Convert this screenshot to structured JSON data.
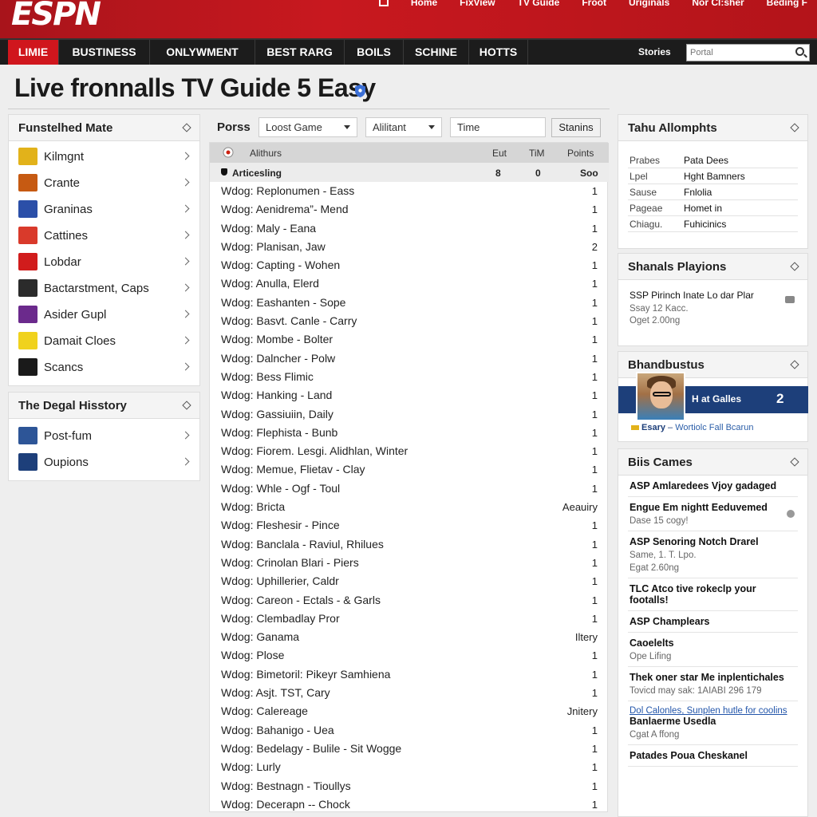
{
  "header": {
    "logo": "ESPN",
    "top_links": [
      "Home",
      "FixView",
      "TV Guide",
      "Froot",
      "Uriginals",
      "Nor Cl:sher",
      "Beding F"
    ]
  },
  "nav": {
    "items": [
      "LIMIE",
      "BUSTINESS",
      "ONLYWMENT",
      "BEST RARG",
      "BOILS",
      "SCHINE",
      "HOTTS"
    ],
    "stories": "Stories",
    "search_placeholder": "Portal"
  },
  "page": {
    "title": "Live fronnalls TV Guide 5 Easy"
  },
  "left": {
    "panel1": {
      "title": "Funstelhed Mate",
      "items": [
        {
          "label": "Kilmgnt",
          "color": "#e2b21a"
        },
        {
          "label": "Crante",
          "color": "#c65a12"
        },
        {
          "label": "Graninas",
          "color": "#2b4fa8"
        },
        {
          "label": "Cattines",
          "color": "#d93a2b"
        },
        {
          "label": "Lobdar",
          "color": "#d11c1c"
        },
        {
          "label": "Bactarstment, Caps",
          "color": "#2b2b2b"
        },
        {
          "label": "Asider Gupl",
          "color": "#6b2a8c"
        },
        {
          "label": "Damait Cloes",
          "color": "#f0d21d"
        },
        {
          "label": "Scancs",
          "color": "#1a1a1a"
        }
      ]
    },
    "panel2": {
      "title": "The Degal Hisstory",
      "items": [
        {
          "label": "Post-fum",
          "color": "#2d5597"
        },
        {
          "label": "Oupions",
          "color": "#1d3f7a"
        }
      ]
    }
  },
  "main": {
    "filters": {
      "label": "Porss",
      "select1": "Loost Game",
      "select2": "Alilitant",
      "input": "Time",
      "button": "Stanins"
    },
    "header": {
      "col1": "Alithurs",
      "col2": "Eut",
      "col3": "TiM",
      "col4": "Points"
    },
    "subheader": {
      "col1": "Articesling",
      "col2": "8",
      "col3": "0",
      "col4": "Soo"
    },
    "rows": [
      {
        "text": "Wdog: Replonumen - Eass",
        "value": "1"
      },
      {
        "text": "Wdog: Aenidrema”- Mend",
        "value": "1"
      },
      {
        "text": "Wdog: Maly - Eana",
        "value": "1"
      },
      {
        "text": "Wdog: Planisan, Jaw",
        "value": "2"
      },
      {
        "text": "Wdog: Capting - Wohen",
        "value": "1"
      },
      {
        "text": "Wdog: Anulla, Elerd",
        "value": "1"
      },
      {
        "text": "Wdog: Eashanten - Sope",
        "value": "1"
      },
      {
        "text": "Wdog: Basvt. Canle - Carry",
        "value": "1"
      },
      {
        "text": "Wdog: Mombe - Bolter",
        "value": "1"
      },
      {
        "text": "Wdog: Dalncher - Polw",
        "value": "1"
      },
      {
        "text": "Wdog: Bess Flimic",
        "value": "1"
      },
      {
        "text": "Wdog: Hanking - Land",
        "value": "1"
      },
      {
        "text": "Wdog: Gassiuiin, Daily",
        "value": "1"
      },
      {
        "text": "Wdog: Flephista - Bunb",
        "value": "1"
      },
      {
        "text": "Wdog: Fiorem. Lesgi. Alidhlan, Winter",
        "value": "1"
      },
      {
        "text": "Wdog: Memue, Flietav - Clay",
        "value": "1"
      },
      {
        "text": "Wdog: Whle - Ogf - Toul",
        "value": "1"
      },
      {
        "text": "Wdog: Bricta",
        "value": "Aeauiry"
      },
      {
        "text": "Wdog: Fleshesir - Pince",
        "value": "1"
      },
      {
        "text": "Wdog: Banclala - Raviul, Rhilues",
        "value": "1"
      },
      {
        "text": "Wdog: Crinolan Blari - Piers",
        "value": "1"
      },
      {
        "text": "Wdog: Uphillerier, Caldr",
        "value": "1"
      },
      {
        "text": "Wdog: Careon - Ectals - & Garls",
        "value": "1"
      },
      {
        "text": "Wdog: Clembadlay Pror",
        "value": "1"
      },
      {
        "text": "Wdog: Ganama",
        "value": "Iltery"
      },
      {
        "text": "Wdog: Plose",
        "value": "1"
      },
      {
        "text": "Wdog: Bimetoril: Pikeyr Samhiena",
        "value": "1"
      },
      {
        "text": "Wdog: Asjt. TST, Cary",
        "value": "1"
      },
      {
        "text": "Wdog: Calereage",
        "value": "Jnitery"
      },
      {
        "text": "Wdog: Bahanigo - Uea",
        "value": "1"
      },
      {
        "text": "Wdog: Bedelagy - Bulile - Sit Wogge",
        "value": "1"
      },
      {
        "text": "Wdog: Lurly",
        "value": "1"
      },
      {
        "text": "Wdog: Bestnagn - Tioullys",
        "value": "1"
      },
      {
        "text": "Wdog: Decerapn -- Chock",
        "value": "1"
      }
    ]
  },
  "right": {
    "panel1": {
      "title": "Tahu Allomphts",
      "rows": [
        {
          "k": "Prabes",
          "v": "Pata Dees"
        },
        {
          "k": "Lpel",
          "v": "Hght Bamners"
        },
        {
          "k": "Sause",
          "v": "Fnlolia"
        },
        {
          "k": "Pageae",
          "v": "Homet in"
        },
        {
          "k": "Chiagu.",
          "v": "Fuhicinics"
        }
      ]
    },
    "panel2": {
      "title": "Shanals Playions",
      "item_title": "SSP Pirinch Inate Lo dar Plar",
      "item_meta1": "Ssay 12 Kacc.",
      "item_meta2": "Oget 2.00ng"
    },
    "panel3": {
      "title": "Bhandbustus",
      "score_label": "H at Galles",
      "score_value": "2",
      "caption_a": "Esary",
      "caption_b": "Wortiolc Fall Bcarun"
    },
    "panel4": {
      "title": "Biis Cames",
      "items": [
        {
          "title": "ASP Amlaredees Vjoy gadaged",
          "meta": ""
        },
        {
          "title": "Engue Em nightt Eeduvemed",
          "meta": "Dase 15 cogy!"
        },
        {
          "title": "ASP Senoring Notch Drarel",
          "meta": "Same, 1. T. Lpo.",
          "meta2": "Egat 2.60ng"
        },
        {
          "title": "TLC Atco tive rokeclp your footalls!",
          "meta": ""
        },
        {
          "title": "ASP Champlears",
          "meta": ""
        },
        {
          "title": "Caoelelts",
          "meta": "Ope Lifing"
        },
        {
          "title": "Thek oner star Me inplentichales",
          "meta": "Tovicd may sak: 1AIABI 296 179"
        },
        {
          "title": "Banlaerme Usedla",
          "meta": "Cgat A ffong",
          "link": "Dol Calonles, Sunplen hutle for coolins"
        },
        {
          "title": "Patades Poua Cheskanel",
          "meta": ""
        }
      ]
    }
  }
}
